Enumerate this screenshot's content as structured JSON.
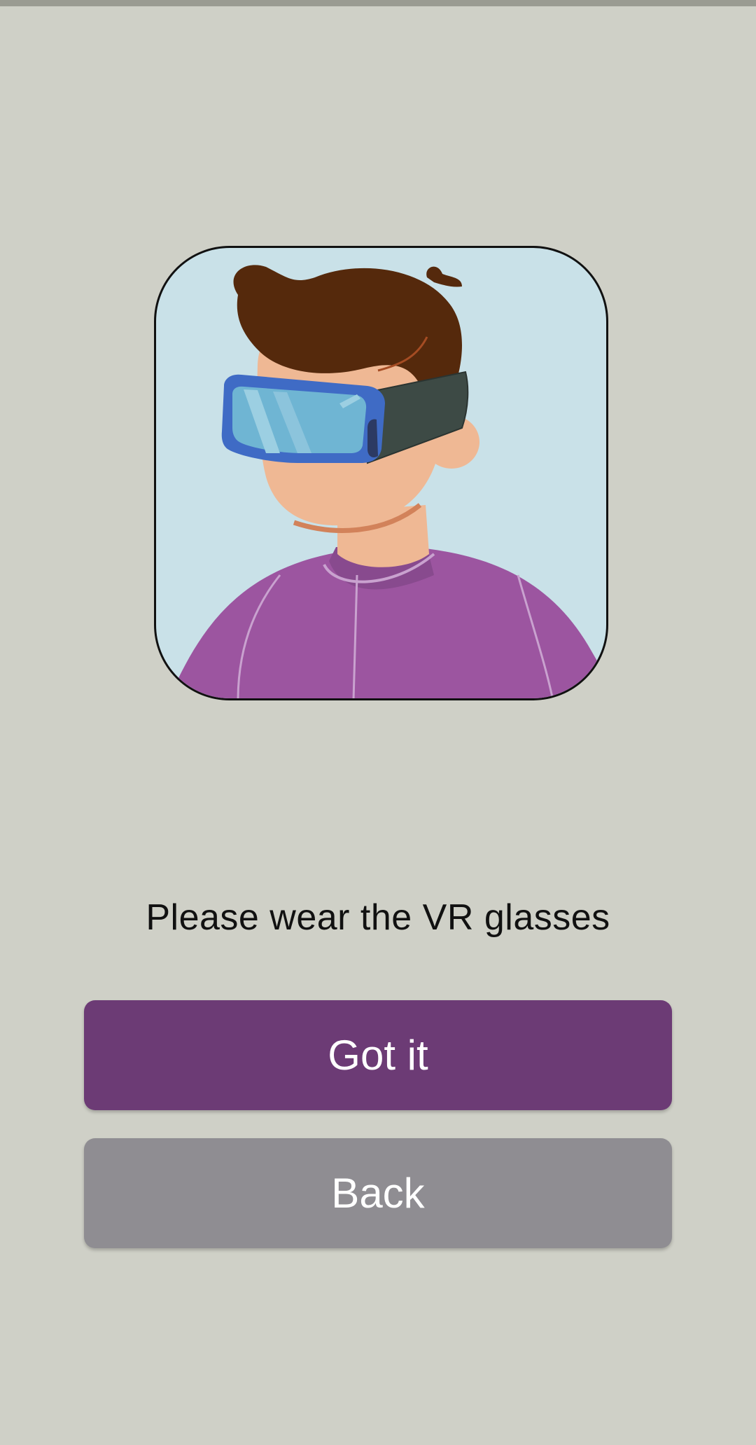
{
  "screen": {
    "background_color": "#cfd0c7"
  },
  "illustration": {
    "icon": "person-wearing-vr-headset-illustration",
    "background_color": "#c9e1e8"
  },
  "instruction": {
    "text": "Please wear the VR glasses"
  },
  "actions": {
    "primary_label": "Got it",
    "primary_color": "#6c3b75",
    "secondary_label": "Back",
    "secondary_color": "#8f8d92"
  }
}
